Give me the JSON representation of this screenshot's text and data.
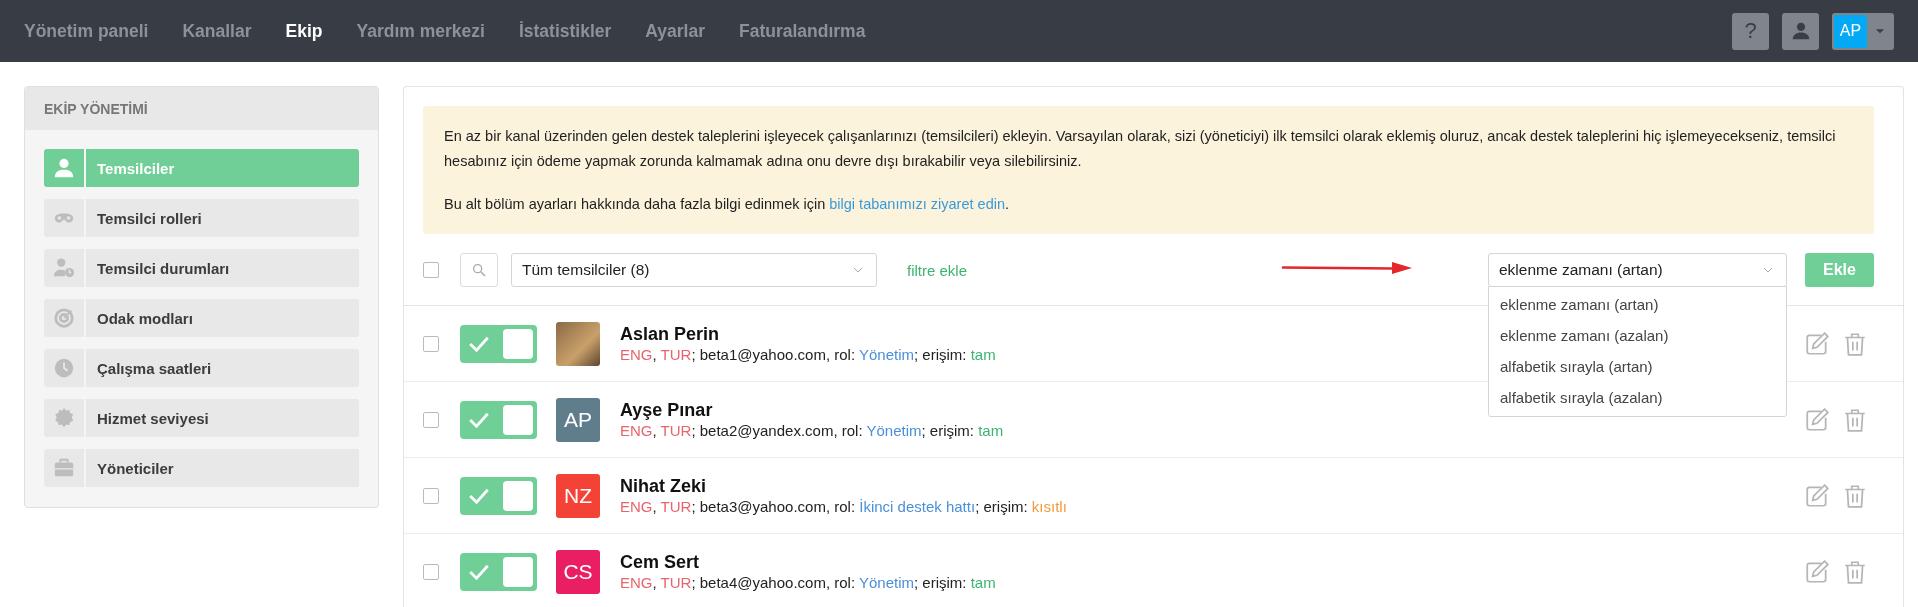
{
  "nav": {
    "items": [
      {
        "label": "Yönetim paneli",
        "selected": false
      },
      {
        "label": "Kanallar",
        "selected": false
      },
      {
        "label": "Ekip",
        "selected": true
      },
      {
        "label": "Yardım merkezi",
        "selected": false
      },
      {
        "label": "İstatistikler",
        "selected": false
      },
      {
        "label": "Ayarlar",
        "selected": false
      },
      {
        "label": "Faturalandırma",
        "selected": false
      }
    ],
    "help": "?",
    "user_initials": "AP"
  },
  "sidebar": {
    "title": "EKİP YÖNETİMİ",
    "items": [
      {
        "label": "Temsilciler",
        "selected": true
      },
      {
        "label": "Temsilci rolleri",
        "selected": false
      },
      {
        "label": "Temsilci durumları",
        "selected": false
      },
      {
        "label": "Odak modları",
        "selected": false
      },
      {
        "label": "Çalışma saatleri",
        "selected": false
      },
      {
        "label": "Hizmet seviyesi",
        "selected": false
      },
      {
        "label": "Yöneticiler",
        "selected": false
      }
    ]
  },
  "info": {
    "text": "En az bir kanal üzerinden gelen destek taleplerini işleyecek çalışanlarınızı (temsilcileri) ekleyin. Varsayılan olarak, sizi (yöneticiyi) ilk temsilci olarak eklemiş oluruz, ancak destek taleplerini hiç işlemeyecekseniz, temsilci hesabınız için ödeme yapmak zorunda kalmamak adına onu devre dışı bırakabilir veya silebilirsiniz.",
    "more_before": "Bu alt bölüm ayarları hakkında daha fazla bilgi edinmek için ",
    "more_link": "bilgi tabanımızı ziyaret edin",
    "more_after": "."
  },
  "toolbar": {
    "select_all": {
      "checked": false
    },
    "filter": {
      "value": "Tüm temsilciler (8)"
    },
    "add_filter": "filtre ekle",
    "sort": {
      "value": "eklenme zamanı (artan)",
      "expanded": true,
      "options": [
        "eklenme zamanı (artan)",
        "eklenme zamanı (azalan)",
        "alfabetik sırayla (artan)",
        "alfabetik sırayla (azalan)"
      ]
    },
    "add_button": "Ekle"
  },
  "agents": [
    {
      "checked": false,
      "on": true,
      "avatar": {
        "kind": "photo"
      },
      "name": "Aslan Perin",
      "details": [
        {
          "kind": "lang",
          "text": "ENG"
        },
        {
          "kind": "plain",
          "text": ", "
        },
        {
          "kind": "lang",
          "text": "TUR"
        },
        {
          "kind": "plain",
          "text": "; beta1@yahoo.com, rol: "
        },
        {
          "kind": "role",
          "text": "Yönetim"
        },
        {
          "kind": "plain",
          "text": "; erişim: "
        },
        {
          "kind": "access-full",
          "text": "tam"
        }
      ]
    },
    {
      "checked": false,
      "on": true,
      "avatar": {
        "kind": "initials",
        "text": "AP",
        "color": "#607d8b"
      },
      "name": "Ayşe Pınar",
      "details": [
        {
          "kind": "lang",
          "text": "ENG"
        },
        {
          "kind": "plain",
          "text": ", "
        },
        {
          "kind": "lang",
          "text": "TUR"
        },
        {
          "kind": "plain",
          "text": "; beta2@yandex.com, rol: "
        },
        {
          "kind": "role",
          "text": "Yönetim"
        },
        {
          "kind": "plain",
          "text": "; erişim: "
        },
        {
          "kind": "access-full",
          "text": "tam"
        }
      ]
    },
    {
      "checked": false,
      "on": true,
      "avatar": {
        "kind": "initials",
        "text": "NZ",
        "color": "#f44336"
      },
      "name": "Nihat Zeki",
      "details": [
        {
          "kind": "lang",
          "text": "ENG"
        },
        {
          "kind": "plain",
          "text": ", "
        },
        {
          "kind": "lang",
          "text": "TUR"
        },
        {
          "kind": "plain",
          "text": "; beta3@yahoo.com, rol: "
        },
        {
          "kind": "role",
          "text": "İkinci destek hattı"
        },
        {
          "kind": "plain",
          "text": "; erişim: "
        },
        {
          "kind": "access-restricted",
          "text": "kısıtlı"
        }
      ]
    },
    {
      "checked": false,
      "on": true,
      "avatar": {
        "kind": "initials",
        "text": "CS",
        "color": "#e91e63"
      },
      "name": "Cem Sert",
      "details": [
        {
          "kind": "lang",
          "text": "ENG"
        },
        {
          "kind": "plain",
          "text": ", "
        },
        {
          "kind": "lang",
          "text": "TUR"
        },
        {
          "kind": "plain",
          "text": "; beta4@yahoo.com, rol: "
        },
        {
          "kind": "role",
          "text": "Yönetim"
        },
        {
          "kind": "plain",
          "text": "; erişim: "
        },
        {
          "kind": "access-full",
          "text": "tam"
        }
      ]
    }
  ]
}
